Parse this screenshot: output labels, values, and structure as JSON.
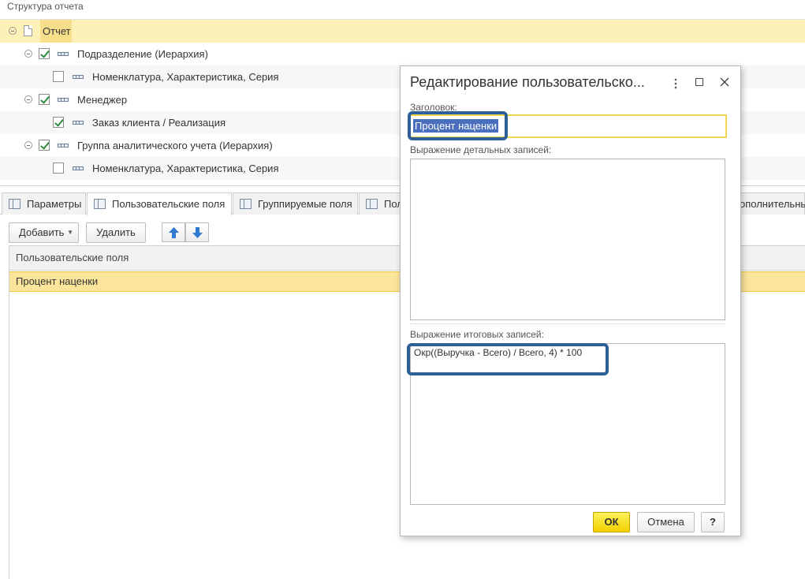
{
  "structure": {
    "title": "Структура отчета",
    "rows": [
      {
        "label": "Отчет"
      },
      {
        "label": "Подразделение (Иерархия)",
        "checked": true
      },
      {
        "label": "Номенклатура, Характеристика, Серия",
        "checked": false
      },
      {
        "label": "Менеджер",
        "checked": true
      },
      {
        "label": "Заказ клиента / Реализация",
        "checked": true
      },
      {
        "label": "Группа аналитического учета (Иерархия)",
        "checked": true
      },
      {
        "label": "Номенклатура, Характеристика, Серия",
        "checked": false
      }
    ]
  },
  "tabs": [
    {
      "label": "Параметры"
    },
    {
      "label": "Пользовательские поля"
    },
    {
      "label": "Группируемые поля"
    },
    {
      "label": "Пол"
    },
    {
      "label": "ополнительные"
    }
  ],
  "toolbar": {
    "add_label": "Добавить",
    "delete_label": "Удалить"
  },
  "list": {
    "header": "Пользовательские поля",
    "rows": [
      {
        "label": "Процент наценки"
      }
    ]
  },
  "dialog": {
    "title": "Редактирование пользовательско...",
    "title_field_label": "Заголовок:",
    "title_field_value": "Процент наценки",
    "detail_label": "Выражение детальных записей:",
    "detail_value": "",
    "summary_label": "Выражение итоговых записей:",
    "summary_value": "Окр((Выручка - Всего) / Всего, 4) * 100",
    "ok_label": "ОК",
    "cancel_label": "Отмена",
    "help_label": "?"
  },
  "colors": {
    "selection_yellow": "#fbe59a",
    "highlight_frame": "#2f5f98",
    "ok_button": "#f5d800",
    "checkmark": "#2e8b3a"
  }
}
